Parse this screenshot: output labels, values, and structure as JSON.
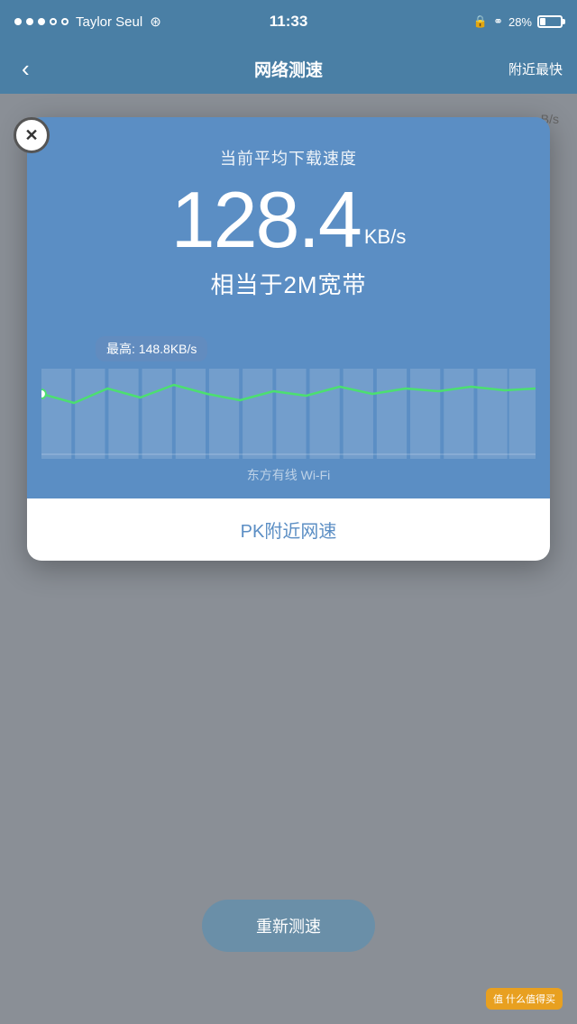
{
  "statusBar": {
    "carrier": "Taylor Seul",
    "time": "11:33",
    "batteryPercent": "28%",
    "dots": [
      true,
      true,
      true,
      false,
      false
    ]
  },
  "navBar": {
    "backLabel": "‹",
    "title": "网络测速",
    "rightLabel": "附近最快"
  },
  "bgSpeedLabel": "B/s",
  "modal": {
    "closeLabel": "✕",
    "subtitle": "当前平均下载速度",
    "speedNumber": "128.4",
    "speedUnit": "KB/s",
    "speedEquiv": "相当于2M宽带",
    "tooltipLabel": "最高: 148.8KB/s",
    "networkLabel": "东方有线  Wi-Fi",
    "pkLabel": "PK附近网速",
    "chartData": [
      130,
      125,
      132,
      128,
      135,
      130,
      127,
      133,
      129,
      134,
      128,
      132,
      130,
      136,
      131
    ],
    "chartMax": 148.8,
    "chartMin": 100
  },
  "retestButton": {
    "label": "重新测速"
  },
  "bottomBadge": {
    "label": "值 什么值得买"
  }
}
